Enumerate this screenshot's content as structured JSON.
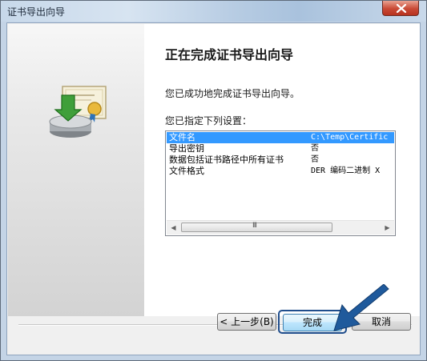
{
  "window": {
    "title": "证书导出向导",
    "close_glyph": "✕"
  },
  "wizard": {
    "heading": "正在完成证书导出向导",
    "description": "您已成功地完成证书导出向导。",
    "settings_label": "您已指定下列设置：",
    "settings": [
      {
        "name": "文件名",
        "value": "C:\\Temp\\Certific",
        "selected": true
      },
      {
        "name": "导出密钥",
        "value": "否",
        "selected": false
      },
      {
        "name": "数据包括证书路径中所有证书",
        "value": "否",
        "selected": false
      },
      {
        "name": "文件格式",
        "value": "DER 编码二进制 X",
        "selected": false
      }
    ],
    "scroll_left": "◀",
    "scroll_right": "▶",
    "scroll_grip": "III"
  },
  "buttons": {
    "back": "< 上一步(B)",
    "finish": "完成",
    "cancel": "取消"
  },
  "icons": {
    "illustration": "certificate-export-icon",
    "pointer": "blue-arrow-icon"
  },
  "colors": {
    "selection": "#3399ff",
    "highlight_border": "#1f4d8c",
    "arrow": "#1f5a9c"
  }
}
